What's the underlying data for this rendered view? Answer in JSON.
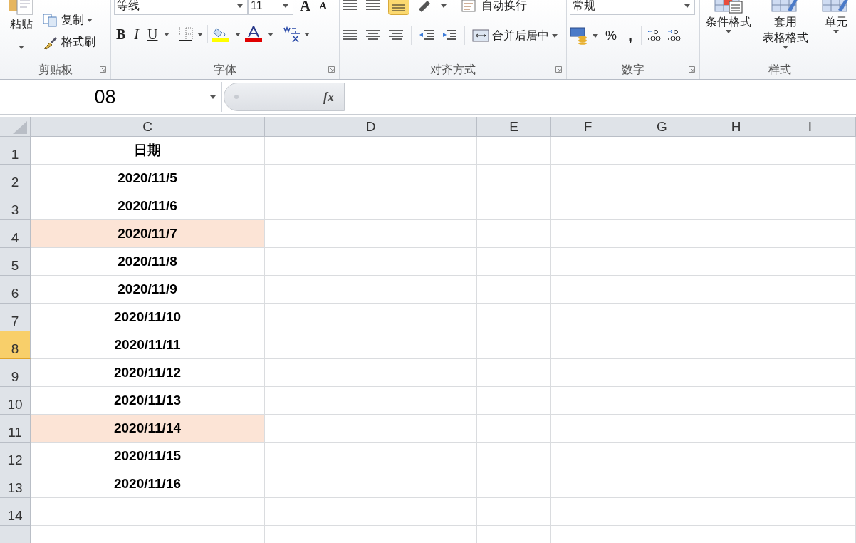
{
  "ribbon": {
    "groups": [
      {
        "kind": "clipboard",
        "label": "剪贴板",
        "paste": "粘贴",
        "items": [
          {
            "label": "复制",
            "dropdown": true
          },
          {
            "label": "格式刷",
            "dropdown": false
          }
        ]
      },
      {
        "kind": "font",
        "label": "字体",
        "font_name": "等线",
        "font_size": "11",
        "size_buttons": [
          "A",
          "A"
        ],
        "style_buttons": [
          "B",
          "I",
          "U"
        ]
      },
      {
        "kind": "alignment",
        "label": "对齐方式",
        "wrap_text": "自动换行",
        "merge": "合并后居中"
      },
      {
        "kind": "number",
        "label": "数字",
        "format": "常规",
        "symbols": [
          "%",
          ","
        ]
      },
      {
        "kind": "styles",
        "label": "样式",
        "items": [
          {
            "lines": [
              "条件格式"
            ]
          },
          {
            "lines": [
              "套用",
              "表格格式"
            ]
          },
          {
            "lines": [
              "单元"
            ]
          }
        ]
      }
    ]
  },
  "formula_bar": {
    "name_box": "08",
    "fx": "fx"
  },
  "sheet": {
    "columns": [
      {
        "label": "C"
      },
      {
        "label": "D"
      },
      {
        "label": "E"
      },
      {
        "label": "F"
      },
      {
        "label": "G"
      },
      {
        "label": "H"
      },
      {
        "label": "I"
      }
    ],
    "rows": [
      {
        "number": "1",
        "selected": false,
        "highlighted": false,
        "value": "日期"
      },
      {
        "number": "2",
        "selected": false,
        "highlighted": false,
        "value": "2020/11/5"
      },
      {
        "number": "3",
        "selected": false,
        "highlighted": false,
        "value": "2020/11/6"
      },
      {
        "number": "4",
        "selected": false,
        "highlighted": true,
        "value": "2020/11/7"
      },
      {
        "number": "5",
        "selected": false,
        "highlighted": false,
        "value": "2020/11/8"
      },
      {
        "number": "6",
        "selected": false,
        "highlighted": false,
        "value": "2020/11/9"
      },
      {
        "number": "7",
        "selected": false,
        "highlighted": false,
        "value": "2020/11/10"
      },
      {
        "number": "8",
        "selected": true,
        "highlighted": false,
        "value": "2020/11/11"
      },
      {
        "number": "9",
        "selected": false,
        "highlighted": false,
        "value": "2020/11/12"
      },
      {
        "number": "10",
        "selected": false,
        "highlighted": false,
        "value": "2020/11/13"
      },
      {
        "number": "11",
        "selected": false,
        "highlighted": true,
        "value": "2020/11/14"
      },
      {
        "number": "12",
        "selected": false,
        "highlighted": false,
        "value": "2020/11/15"
      },
      {
        "number": "13",
        "selected": false,
        "highlighted": false,
        "value": "2020/11/16"
      },
      {
        "number": "14",
        "selected": false,
        "highlighted": false
      }
    ]
  }
}
